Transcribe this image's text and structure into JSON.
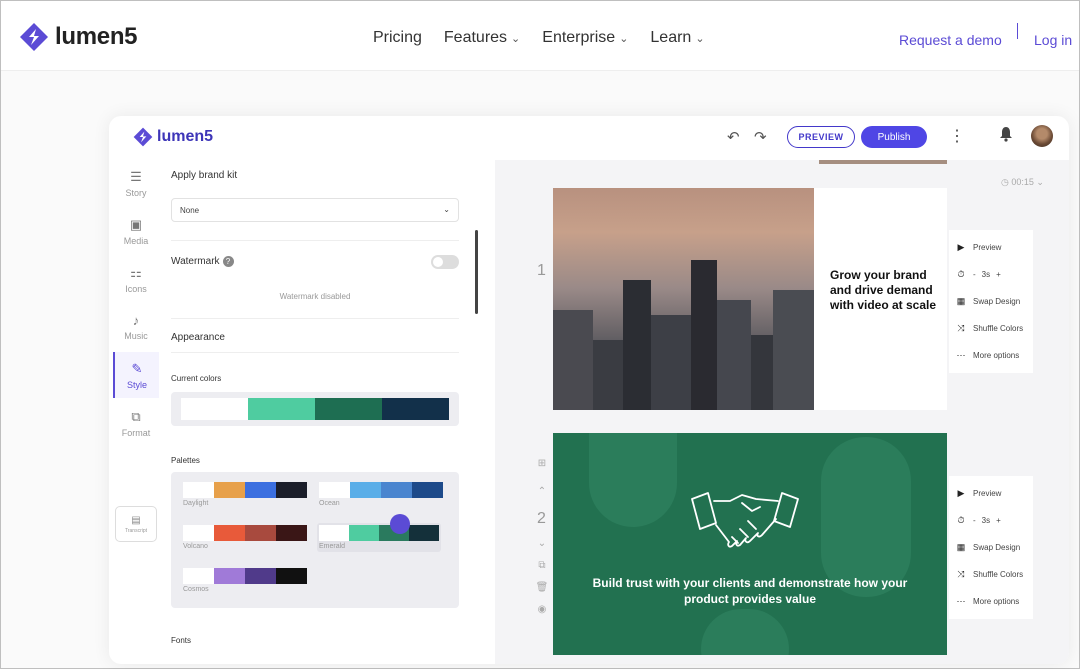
{
  "site_nav": {
    "brand": "lumen5",
    "menu": [
      {
        "label": "Pricing",
        "has_dropdown": false
      },
      {
        "label": "Features",
        "has_dropdown": true
      },
      {
        "label": "Enterprise",
        "has_dropdown": true
      },
      {
        "label": "Learn",
        "has_dropdown": true
      }
    ],
    "request_demo": "Request a demo",
    "login": "Log in"
  },
  "app": {
    "brand": "lumen5",
    "preview_label": "PREVIEW",
    "publish_label": "Publish",
    "timer": "00:15",
    "sidebar": [
      {
        "label": "Story",
        "icon": "story-icon"
      },
      {
        "label": "Media",
        "icon": "media-icon"
      },
      {
        "label": "Icons",
        "icon": "icons-icon"
      },
      {
        "label": "Music",
        "icon": "music-icon"
      },
      {
        "label": "Style",
        "icon": "style-icon",
        "active": true
      },
      {
        "label": "Format",
        "icon": "format-icon"
      }
    ],
    "transcript_label": "Transcript",
    "panel": {
      "brand_kit_label": "Apply brand kit",
      "brand_kit_value": "None",
      "watermark_label": "Watermark",
      "watermark_status": "Watermark disabled",
      "appearance_label": "Appearance",
      "current_colors_label": "Current colors",
      "current_colors": [
        "#ffffff",
        "#4fcca0",
        "#1e6e52",
        "#12304a"
      ],
      "palettes_label": "Palettes",
      "palettes": [
        {
          "name": "Daylight",
          "colors": [
            "#ffffff",
            "#e7a04a",
            "#3b6fe0",
            "#1b1e2a"
          ]
        },
        {
          "name": "Ocean",
          "colors": [
            "#ffffff",
            "#5aaee8",
            "#4a85cf",
            "#1d4a8a"
          ]
        },
        {
          "name": "Volcano",
          "colors": [
            "#ffffff",
            "#e85a3a",
            "#a84a3e",
            "#3a1616"
          ]
        },
        {
          "name": "Emerald",
          "colors": [
            "#ffffff",
            "#4fcca0",
            "#2a7a5e",
            "#14303a"
          ]
        },
        {
          "name": "Cosmos",
          "colors": [
            "#ffffff",
            "#a07ad8",
            "#503a8a",
            "#111111"
          ]
        }
      ],
      "fonts_label": "Fonts"
    },
    "slides": [
      {
        "number": "1",
        "text": "Grow your brand and drive demand with video at scale",
        "actions": {
          "preview": "Preview",
          "duration": "3s",
          "swap": "Swap Design",
          "shuffle": "Shuffle Colors",
          "more": "More options"
        }
      },
      {
        "number": "2",
        "text": "Build trust with your clients and demonstrate how your product provides value",
        "bg_color": "#227150",
        "actions": {
          "preview": "Preview",
          "duration": "3s",
          "swap": "Swap Design",
          "shuffle": "Shuffle Colors",
          "more": "More options"
        }
      }
    ]
  }
}
